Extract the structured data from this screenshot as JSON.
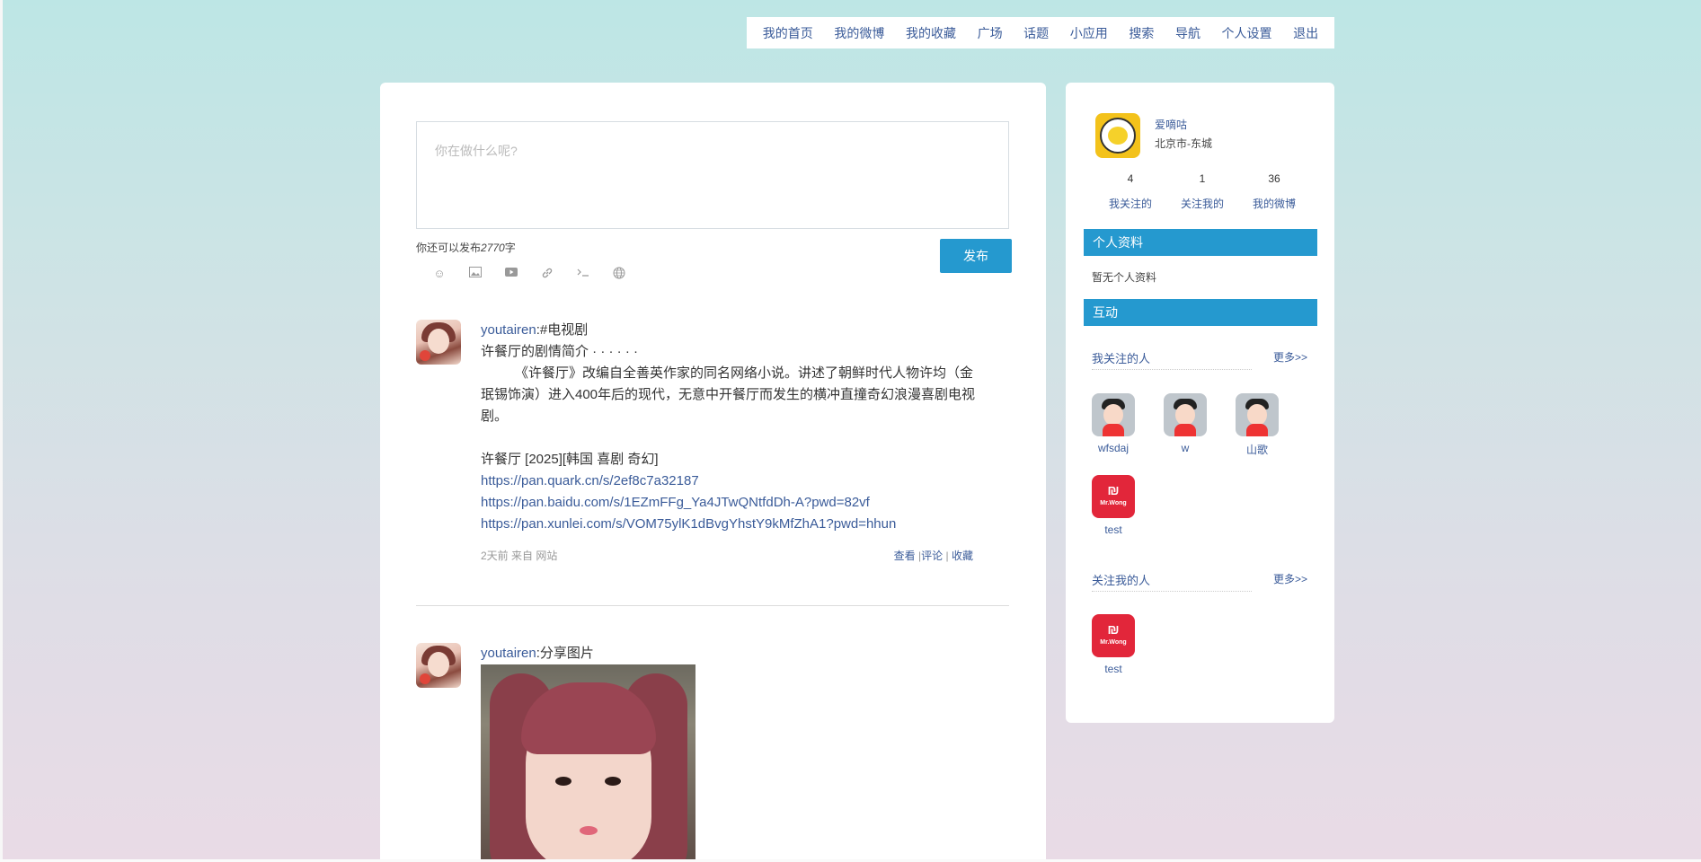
{
  "nav": {
    "items": [
      "我的首页",
      "我的微博",
      "我的收藏",
      "广场",
      "话题",
      "小应用",
      "搜索",
      "导航",
      "个人设置",
      "退出"
    ]
  },
  "composer": {
    "placeholder": "你在做什么呢?",
    "counter_prefix": "你还可以发布",
    "counter_value": "2770",
    "counter_suffix": "字",
    "publish_label": "发布",
    "tools": [
      "smile-icon",
      "image-icon",
      "video-icon",
      "link-icon",
      "terminal-icon",
      "globe-icon"
    ]
  },
  "posts": [
    {
      "user": "youtairen",
      "colon": ":",
      "text_lines": [
        "#电视剧",
        "许餐厅的剧情简介 · · · · · ·"
      ],
      "paragraph": "《许餐厅》改编自全善英作家的同名网络小说。讲述了朝鲜时代人物许均（金珉锡饰演）进入400年后的现代，无意中开餐厅而发生的横冲直撞奇幻浪漫喜剧电视剧。",
      "title_line": "许餐厅 [2025][韩国 喜剧 奇幻]",
      "links": [
        "https://pan.quark.cn/s/2ef8c7a32187",
        "https://pan.baidu.com/s/1EZmFFg_Ya4JTwQNtfdDh-A?pwd=82vf",
        "https://pan.xunlei.com/s/VOM75ylK1dBvgYhstY9kMfZhA1?pwd=hhun"
      ],
      "meta": "2天前 来自 网站",
      "actions": {
        "view": "查看",
        "comment": "评论",
        "fav": "收藏",
        "sep": "|"
      }
    },
    {
      "user": "youtairen",
      "colon": ":",
      "text": "分享图片"
    }
  ],
  "sidebar": {
    "username": "爱嘀咕",
    "location": "北京市-东城",
    "stats": [
      {
        "value": "4",
        "label": "我关注的"
      },
      {
        "value": "1",
        "label": "关注我的"
      },
      {
        "value": "36",
        "label": "我的微博"
      }
    ],
    "profile_title": "个人资料",
    "profile_empty": "暂无个人资料",
    "interact_title": "互动",
    "following_title": "我关注的人",
    "followers_title": "关注我的人",
    "more_label": "更多>>",
    "following": [
      "wfsdaj",
      "w",
      "山歌",
      "test"
    ],
    "followers": [
      "test"
    ],
    "badge_text": "Mr.Wong"
  },
  "colors": {
    "accent": "#2599cf",
    "link": "#3a5b99"
  }
}
